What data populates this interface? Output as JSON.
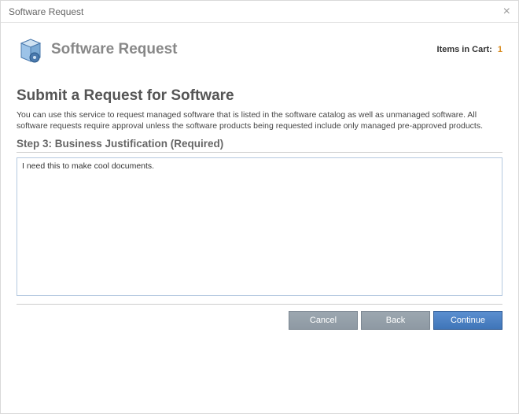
{
  "window": {
    "title": "Software Request"
  },
  "header": {
    "title": "Software Request",
    "cart_label": "Items in Cart:",
    "cart_count": "1"
  },
  "main": {
    "title": "Submit a Request for Software",
    "description": "You can use this service to request managed software that is listed in the software catalog as well as unmanaged software. All software requests require approval unless the software products being requested include only managed pre-approved products."
  },
  "step": {
    "title": "Step 3: Business Justification (Required)",
    "value": "I need this to make cool documents."
  },
  "buttons": {
    "cancel": "Cancel",
    "back": "Back",
    "continue": "Continue"
  }
}
